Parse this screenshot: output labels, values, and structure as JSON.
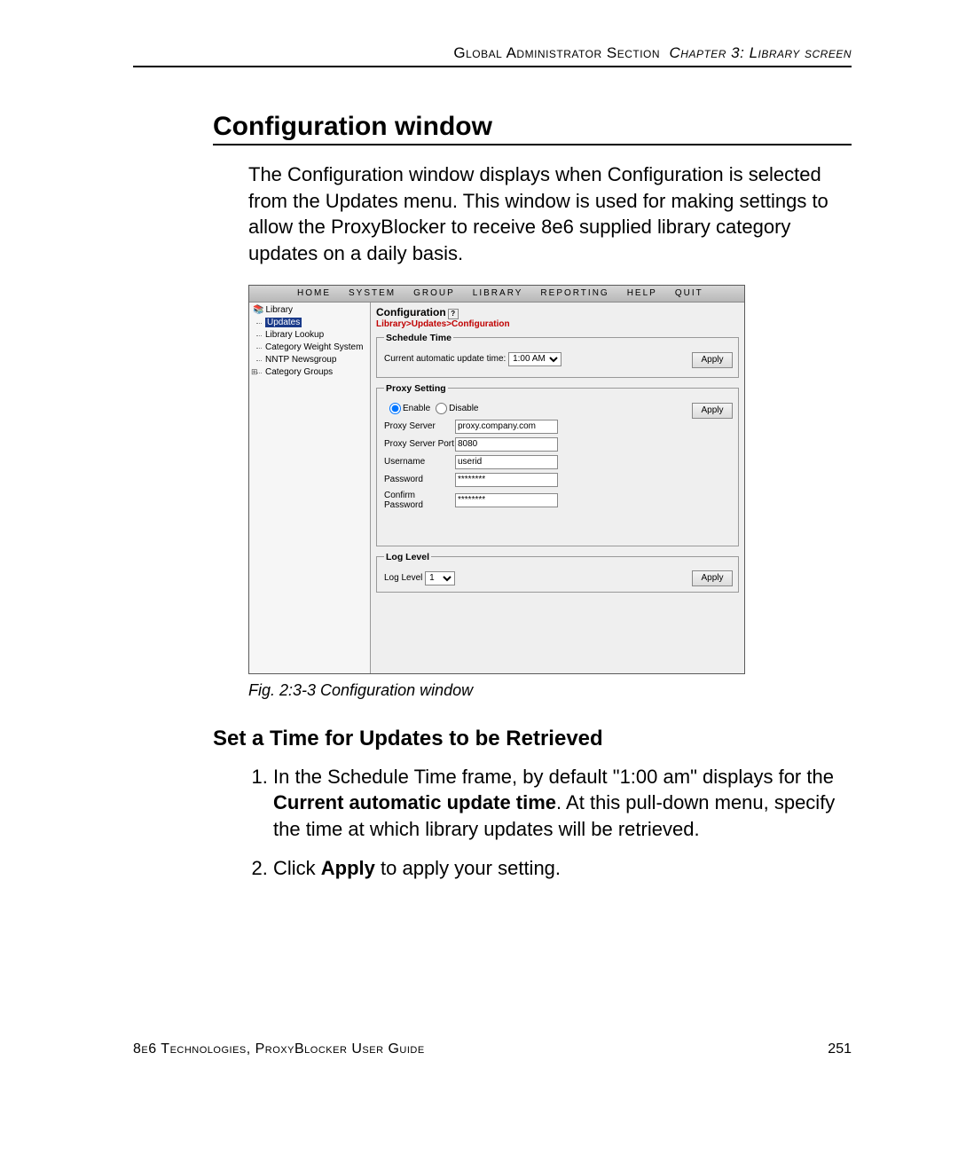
{
  "header": {
    "left": "Global Administrator Section",
    "right_prefix": "Chapter 3: ",
    "right_title": "Library screen"
  },
  "section_title": "Configuration window",
  "intro_paragraph": "The Configuration window displays when Configuration is selected from the Updates menu. This window is used for making settings to allow the ProxyBlocker to receive 8e6 supplied library category updates on a daily basis.",
  "figure_caption": "Fig. 2:3-3  Configuration window",
  "subsection_title": "Set a Time for Updates to be Retrieved",
  "steps": {
    "s1a": "In the Schedule Time frame, by default \"1:00 am\" displays for the ",
    "s1b_bold": "Current automatic update time",
    "s1c": ". At this pull-down menu, specify the time at which library updates will be retrieved.",
    "s2a": "Click ",
    "s2b_bold": "Apply",
    "s2c": " to apply your setting."
  },
  "footer": {
    "left": "8e6 Technologies, ProxyBlocker User Guide",
    "page": "251"
  },
  "app": {
    "menu": {
      "home": "HOME",
      "system": "SYSTEM",
      "group": "GROUP",
      "library": "LIBRARY",
      "reporting": "REPORTING",
      "help": "HELP",
      "quit": "QUIT"
    },
    "tree": {
      "root": "Library",
      "items": [
        "Updates",
        "Library Lookup",
        "Category Weight System",
        "NNTP Newsgroup",
        "Category Groups"
      ]
    },
    "content": {
      "title": "Configuration",
      "breadcrumb": "Library>Updates>Configuration",
      "schedule": {
        "legend": "Schedule Time",
        "label": "Current automatic update time:",
        "value": "1:00 AM",
        "apply": "Apply"
      },
      "proxy": {
        "legend": "Proxy Setting",
        "enable": "Enable",
        "disable": "Disable",
        "server_label": "Proxy Server",
        "server_value": "proxy.company.com",
        "port_label": "Proxy Server Port",
        "port_value": "8080",
        "user_label": "Username",
        "user_value": "userid",
        "pass_label": "Password",
        "pass_value": "********",
        "confirm_label": "Confirm Password",
        "confirm_value": "********",
        "apply": "Apply"
      },
      "log": {
        "legend": "Log Level",
        "label": "Log Level",
        "value": "1",
        "apply": "Apply"
      }
    }
  }
}
